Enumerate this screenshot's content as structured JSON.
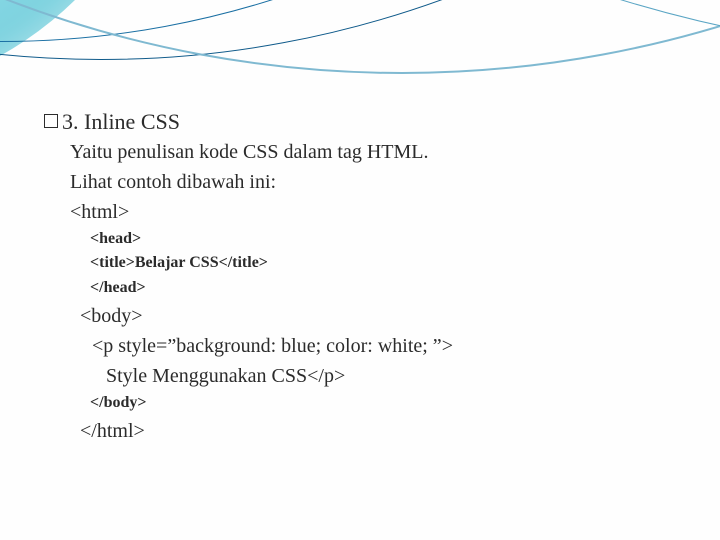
{
  "heading": "3. Inline CSS",
  "lines": {
    "desc1": "Yaitu penulisan kode CSS dalam tag HTML.",
    "desc2": "Lihat contoh dibawah ini:",
    "html_open": "<html>",
    "head_open": "<head>",
    "title_line": "<title>Belajar CSS</title>",
    "head_close": "</head>",
    "body_open": "<body>",
    "p_open": "<p style=”background: blue; color: white; ”>",
    "p_text": "Style Menggunakan CSS</p>",
    "body_close": "</body>",
    "html_close": "</html>"
  }
}
